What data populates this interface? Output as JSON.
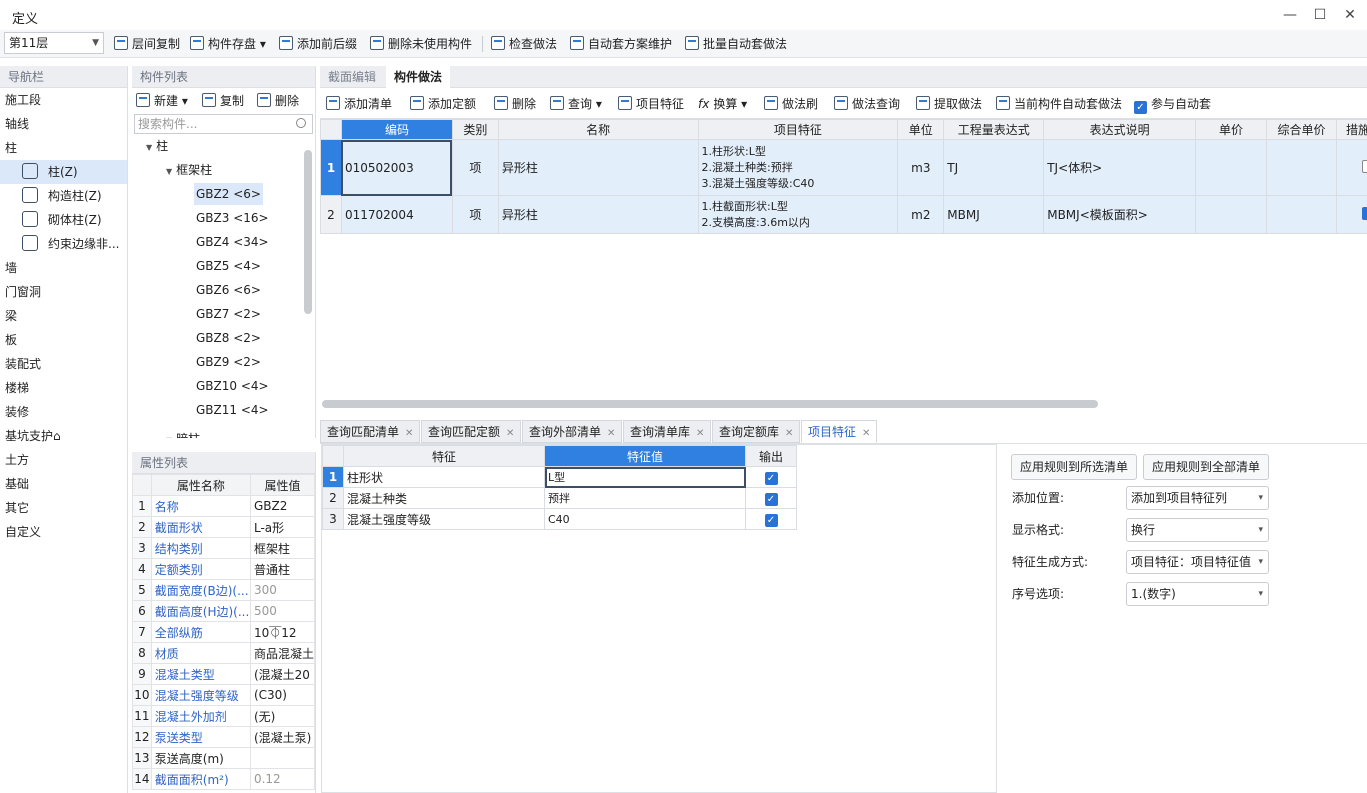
{
  "window": {
    "title": "定义",
    "minimize": "—",
    "maximize": "☐",
    "close": "✕"
  },
  "toolbar": {
    "floor": "第11层",
    "items": [
      "层间复制",
      "构件存盘",
      "添加前后缀",
      "删除未使用构件",
      "检查做法",
      "自动套方案维护",
      "批量自动套做法"
    ]
  },
  "nav": {
    "title": "导航栏",
    "top_items": [
      "施工段",
      "轴线",
      "柱"
    ],
    "sub_items": [
      "柱(Z)",
      "构造柱(Z)",
      "砌体柱(Z)",
      "约束边缘非..."
    ],
    "items": [
      "墙",
      "门窗洞",
      "梁",
      "板",
      "装配式",
      "楼梯",
      "装修",
      "基坑支护⌂",
      "土方",
      "基础",
      "其它",
      "自定义"
    ]
  },
  "component_list": {
    "title": "构件列表",
    "new_label": "新建",
    "copy_label": "复制",
    "delete_label": "删除",
    "search_placeholder": "搜索构件...",
    "tree_root": "柱",
    "tree_group": "框架柱",
    "items": [
      "GBZ2 <6>",
      "GBZ3 <16>",
      "GBZ4 <34>",
      "GBZ5 <4>",
      "GBZ6 <6>",
      "GBZ7 <2>",
      "GBZ8 <2>",
      "GBZ9 <2>",
      "GBZ10 <4>",
      "GBZ11 <4>"
    ],
    "partial_next": "暗柱"
  },
  "attributes": {
    "title": "属性列表",
    "col_name": "属性名称",
    "col_value": "属性值",
    "rows": [
      {
        "no": "1",
        "name": "名称",
        "value": "GBZ2"
      },
      {
        "no": "2",
        "name": "截面形状",
        "value": "L-a形"
      },
      {
        "no": "3",
        "name": "结构类别",
        "value": "框架柱"
      },
      {
        "no": "4",
        "name": "定额类别",
        "value": "普通柱"
      },
      {
        "no": "5",
        "name": "截面宽度(B边)(...",
        "value": "300"
      },
      {
        "no": "6",
        "name": "截面高度(H边)(...",
        "value": "500"
      },
      {
        "no": "7",
        "name": "全部纵筋",
        "value": "10⏁12"
      },
      {
        "no": "8",
        "name": "材质",
        "value": "商品混凝土"
      },
      {
        "no": "9",
        "name": "混凝土类型",
        "value": "(混凝土20"
      },
      {
        "no": "10",
        "name": "混凝土强度等级",
        "value": "(C30)"
      },
      {
        "no": "11",
        "name": "混凝土外加剂",
        "value": "(无)"
      },
      {
        "no": "12",
        "name": "泵送类型",
        "value": "(混凝土泵)"
      },
      {
        "no": "13",
        "name": "泵送高度(m)",
        "value": ""
      },
      {
        "no": "14",
        "name": "截面面积(m²)",
        "value": "0.12"
      }
    ]
  },
  "main_tabs": [
    "截面编辑",
    "构件做法"
  ],
  "method_toolbar": {
    "items": [
      "添加清单",
      "添加定额",
      "删除",
      "查询",
      "项目特征",
      "换算",
      "做法刷",
      "做法查询",
      "提取做法",
      "当前构件自动套做法"
    ],
    "auto_label": "参与自动套"
  },
  "grid": {
    "columns": [
      "编码",
      "类别",
      "名称",
      "项目特征",
      "单位",
      "工程量表达式",
      "表达式说明",
      "单价",
      "综合单价",
      "措施"
    ],
    "rows": [
      {
        "no": "1",
        "code": "010502003",
        "type": "项",
        "name": "异形柱",
        "f1": "1.柱形状:L型",
        "f2": "2.混凝土种类:预拌",
        "f3": "3.混凝土强度等级:C40",
        "unit": "m3",
        "expr": "TJ",
        "desc": "TJ<体积>"
      },
      {
        "no": "2",
        "code": "011702004",
        "type": "项",
        "name": "异形柱",
        "f1": "1.柱截面形状:L型",
        "f2": "2.支模高度:3.6m以内",
        "f3": "",
        "unit": "m2",
        "expr": "MBMJ",
        "desc": "MBMJ<模板面积>"
      }
    ]
  },
  "bottom_tabs": [
    "查询匹配清单",
    "查询匹配定额",
    "查询外部清单",
    "查询清单库",
    "查询定额库",
    "项目特征"
  ],
  "features": {
    "col_feature": "特征",
    "col_value": "特征值",
    "col_output": "输出",
    "rows": [
      {
        "no": "1",
        "feature": "柱形状",
        "value": "L型"
      },
      {
        "no": "2",
        "feature": "混凝土种类",
        "value": "预拌"
      },
      {
        "no": "3",
        "feature": "混凝土强度等级",
        "value": "C40"
      }
    ]
  },
  "rules": {
    "apply_selected": "应用规则到所选清单",
    "apply_all": "应用规则到全部清单",
    "add_position_label": "添加位置:",
    "add_position_value": "添加到项目特征列",
    "display_label": "显示格式:",
    "display_value": "换行",
    "gen_label": "特征生成方式:",
    "gen_value": "项目特征：项目特征值",
    "seq_label": "序号选项:",
    "seq_value": "1.(数字)"
  }
}
